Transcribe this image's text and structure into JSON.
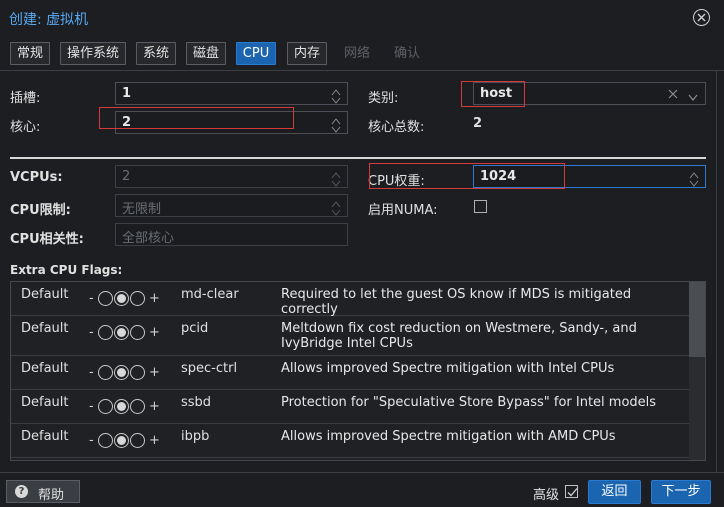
{
  "dialog": {
    "title": "创建: 虚拟机"
  },
  "tabs": [
    {
      "label": "常规",
      "state": "normal"
    },
    {
      "label": "操作系统",
      "state": "normal"
    },
    {
      "label": "系统",
      "state": "normal"
    },
    {
      "label": "磁盘",
      "state": "normal"
    },
    {
      "label": "CPU",
      "state": "active"
    },
    {
      "label": "内存",
      "state": "normal"
    },
    {
      "label": "网络",
      "state": "disabled"
    },
    {
      "label": "确认",
      "state": "disabled"
    }
  ],
  "form": {
    "sockets_label": "插槽:",
    "sockets_value": "1",
    "cores_label": "核心:",
    "cores_value": "2",
    "type_label": "类别:",
    "type_value": "host",
    "total_cores_label": "核心总数:",
    "total_cores_value": "2",
    "vcpus_label": "VCPUs:",
    "vcpus_value": "2",
    "cpu_limit_label": "CPU限制:",
    "cpu_limit_placeholder": "无限制",
    "cpu_affinity_label": "CPU相关性:",
    "cpu_affinity_placeholder": "全部核心",
    "cpu_weight_label": "CPU权重:",
    "cpu_weight_value": "1024",
    "numa_label": "启用NUMA:"
  },
  "flags": {
    "title": "Extra CPU Flags:",
    "rows": [
      {
        "default": "Default",
        "minus": "-",
        "plus": "+",
        "name": "md-clear",
        "desc": "Required to let the guest OS know if MDS is mitigated correctly"
      },
      {
        "default": "Default",
        "minus": "-",
        "plus": "+",
        "name": "pcid",
        "desc": "Meltdown fix cost reduction on Westmere, Sandy-, and IvyBridge Intel CPUs"
      },
      {
        "default": "Default",
        "minus": "-",
        "plus": "+",
        "name": "spec-ctrl",
        "desc": "Allows improved Spectre mitigation with Intel CPUs"
      },
      {
        "default": "Default",
        "minus": "-",
        "plus": "+",
        "name": "ssbd",
        "desc": "Protection for \"Speculative Store Bypass\" for Intel models"
      },
      {
        "default": "Default",
        "minus": "-",
        "plus": "+",
        "name": "ibpb",
        "desc": "Allows improved Spectre mitigation with AMD CPUs"
      }
    ]
  },
  "footer": {
    "help_label": "帮助",
    "advanced_label": "高级",
    "back_label": "返回",
    "next_label": "下一步"
  },
  "colors": {
    "accent": "#1b64b0",
    "title": "#58a8f0",
    "highlight": "#d43a3a",
    "background": "#1c1e22"
  }
}
